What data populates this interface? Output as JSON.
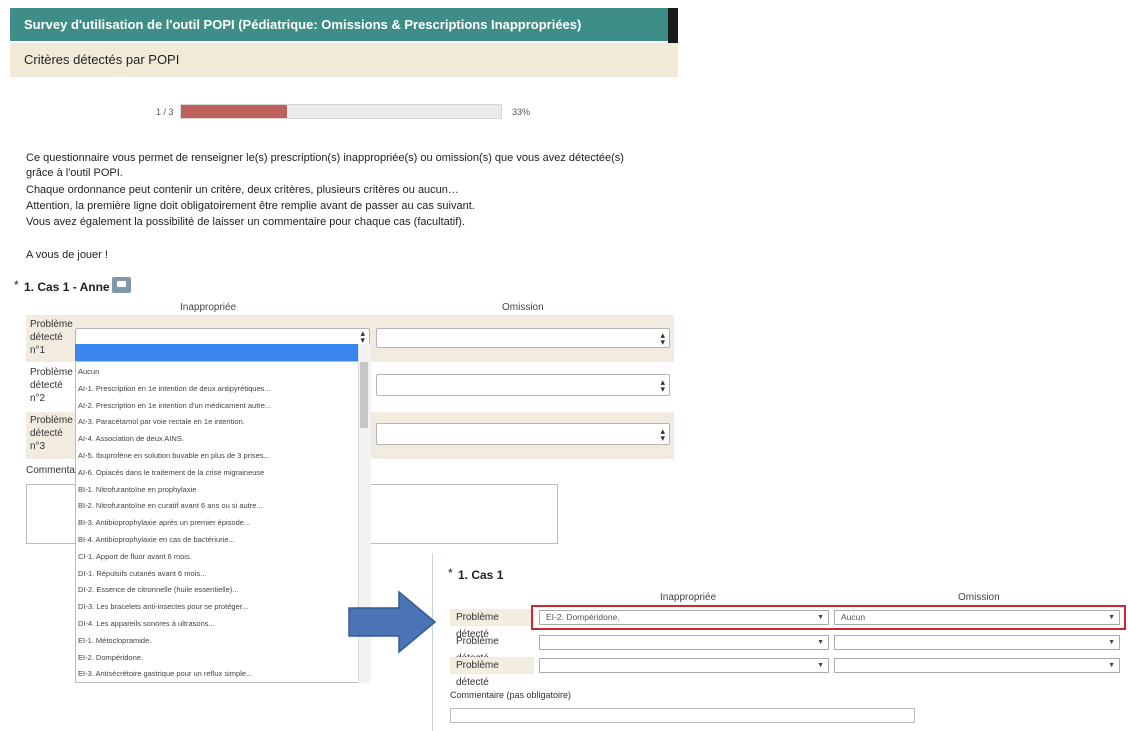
{
  "header": {
    "title": "Survey d'utilisation de l'outil POPI (Pédiatrique: Omissions  & Prescriptions Inappropriées)",
    "subtitle": "Critères détectés par POPI"
  },
  "progress": {
    "label": "1 / 3",
    "percent_text": "33%",
    "fraction": 0.33,
    "fill_color": "#c0605c"
  },
  "intro": {
    "line1": "Ce questionnaire vous permet de renseigner le(s) prescription(s) inappropriée(s) ou omission(s) que vous avez détectée(s)",
    "line2": "grâce à l'outil POPI.",
    "line3": "Chaque ordonnance peut contenir un critère, deux critères, plusieurs critères ou aucun…",
    "line4": "Attention, la première ligne doit obligatoirement être remplie avant de passer au cas suivant.",
    "line5": "Vous avez également la possibilité de laisser un commentaire pour chaque cas (facultatif).",
    "line6": "A vous de jouer !"
  },
  "question1": {
    "star": "*",
    "title": "1. Cas 1 - Anne",
    "col_inappropriate": "Inappropriée",
    "col_omission": "Omission",
    "rows": [
      {
        "l1": "Problème",
        "l2": "détecté",
        "l3": "n°1"
      },
      {
        "l1": "Problème",
        "l2": "détecté",
        "l3": "n°2"
      },
      {
        "l1": "Problème",
        "l2": "détecté",
        "l3": "n°3"
      }
    ],
    "comment_label": "Commenta"
  },
  "dropdown": {
    "items": [
      "Aucun",
      "AI-1. Prescription en 1e intention de deux antipyrétiques...",
      "AI-2. Prescription en 1e intention d'un médicament autre...",
      "AI-3. Paracétamol par voie rectale en 1e intention.",
      "AI-4. Association de deux AINS.",
      "AI-5. Ibuprofène en solution buvable en plus de 3 prises...",
      "AI-6. Opiacés dans le traitement de la crise migraineuse",
      "BI-1. Nitrofurantoïne en prophylaxie",
      "BI-2. Nitrofurantoïne en curatif avant 6 ans ou si autre...",
      "BI-3. Antibioprophylaxie après un premier épisode...",
      "BI-4. Antibioprophylaxie en cas de bactériurie...",
      "CI-1. Apport de fluor avant 6 mois.",
      "DI-1. Répulsifs cutanés avant 6 mois...",
      "DI-2. Essence de citronnelle (huile essentielle)...",
      "DI-3. Les bracelets anti-insectes pour se protéger...",
      "DI-4. Les appareils sonores à ultrasons...",
      "EI-1. Métoclopramide.",
      "EI-2. Dompéridone.",
      "EI-3. Antisécrétoire gastrique pour un reflux simple..."
    ]
  },
  "panel2": {
    "star": "*",
    "title": "1. Cas 1",
    "col_inappropriate": "Inappropriée",
    "col_omission": "Omission",
    "rows": [
      {
        "label": "Problème détecté",
        "inappropriate": "EI-2. Dompéridone.",
        "omission": "Aucun"
      },
      {
        "label": "Problème détecté",
        "inappropriate": "",
        "omission": ""
      },
      {
        "label": "Problème détecté",
        "inappropriate": "",
        "omission": ""
      }
    ],
    "comment_label": "Commentaire (pas obligatoire)"
  }
}
